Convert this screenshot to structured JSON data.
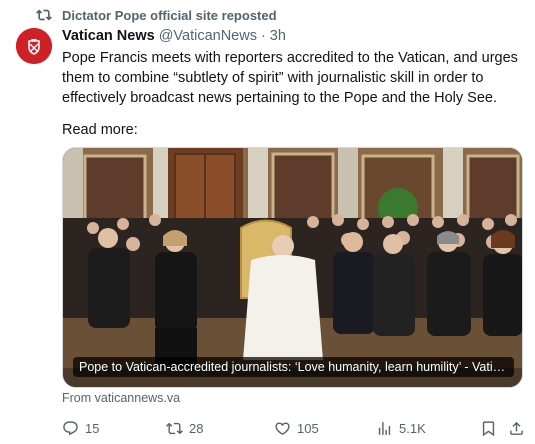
{
  "repost": {
    "icon": "repost-icon",
    "text": "Dictator Pope official site reposted"
  },
  "author": {
    "name": "Vatican News",
    "handle": "@VaticanNews",
    "separator": "·",
    "time": "3h",
    "avatar_color": "#cf1f27"
  },
  "body": {
    "text": "Pope Francis meets with reporters accredited to the Vatican, and urges them to combine “subtlety of spirit” with journalistic skill in order to effectively broadcast news pertaining to the Pope and the Holy See.",
    "read_more": "Read more:"
  },
  "card": {
    "caption": "Pope to Vatican-accredited journalists: ‘Love humanity, learn humility’ - Vatica...",
    "source": "From vaticannews.va"
  },
  "actions": {
    "replies": "15",
    "reposts": "28",
    "likes": "105",
    "views": "5.1K"
  },
  "colors": {
    "text": "#0f1419",
    "muted": "#536471",
    "border": "#cfd9de"
  }
}
